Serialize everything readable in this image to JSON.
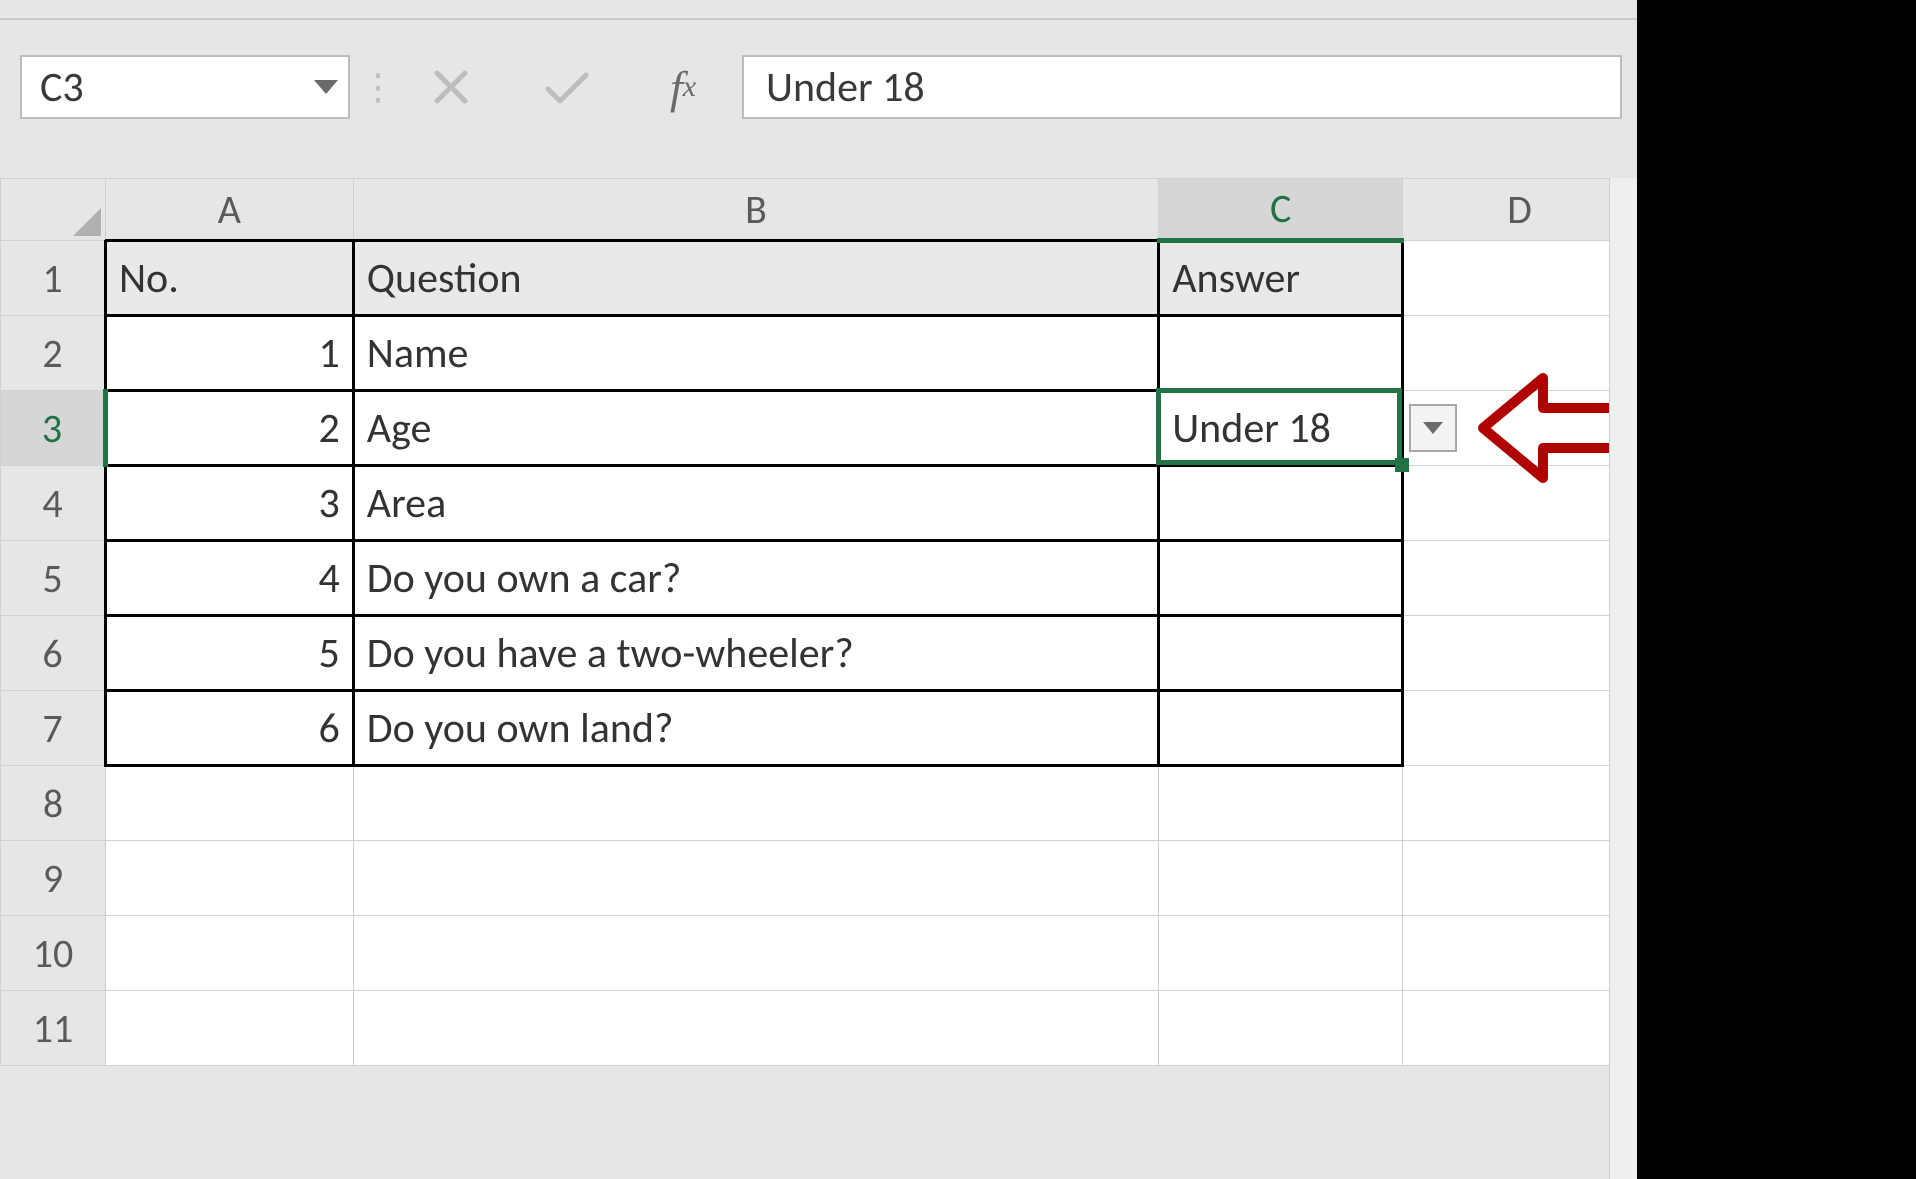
{
  "formula_bar": {
    "name_box": "C3",
    "formula_value": "Under 18"
  },
  "columns": [
    "A",
    "B",
    "C",
    "D"
  ],
  "selected_column": "C",
  "selected_row": 3,
  "rows_visible": [
    1,
    2,
    3,
    4,
    5,
    6,
    7,
    8,
    9,
    10,
    11
  ],
  "table": {
    "header": {
      "no": "No.",
      "question": "Question",
      "answer": "Answer"
    },
    "rows": [
      {
        "no": "1",
        "question": "Name",
        "answer": ""
      },
      {
        "no": "2",
        "question": "Age",
        "answer": "Under 18"
      },
      {
        "no": "3",
        "question": "Area",
        "answer": ""
      },
      {
        "no": "4",
        "question": "Do you own a car?",
        "answer": ""
      },
      {
        "no": "5",
        "question": "Do you have a two-wheeler?",
        "answer": ""
      },
      {
        "no": "6",
        "question": "Do you own land?",
        "answer": ""
      }
    ]
  },
  "annotation": {
    "target": "data-validation-dropdown",
    "color": "#b00000"
  }
}
